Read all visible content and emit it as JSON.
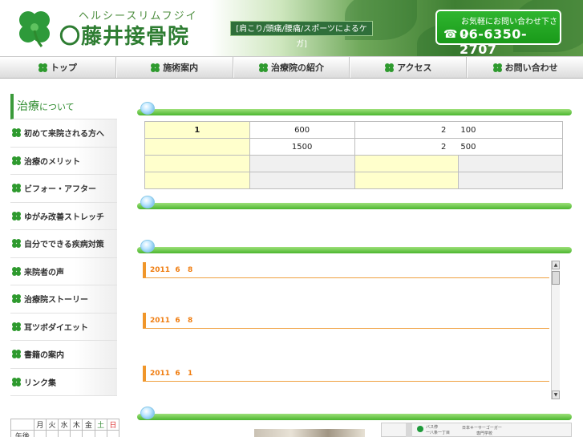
{
  "header": {
    "logo_kana": "ヘルシースリムフジイ",
    "logo_name": "〇藤井接骨院",
    "tagline": "[肩こり/頭痛/腰痛/スポーツによるケガ]",
    "contact_label": "お気軽にお問い合わせ下さい",
    "phone": "06-6350-2707",
    "phone_icon": "☎"
  },
  "nav": {
    "items": [
      "トップ",
      "施術案内",
      "治療院の紹介",
      "アクセス",
      "お問い合わせ"
    ]
  },
  "sidebar": {
    "title_main": "治療",
    "title_sub": "について",
    "items": [
      "初めて来院される方へ",
      "治療のメリット",
      "ビフォー・アフター",
      "ゆがみ改善ストレッチ",
      "自分でできる疾病対策",
      "来院者の声",
      "治療院ストーリー",
      "耳ツボダイエット",
      "書籍の案内",
      "リンク集"
    ]
  },
  "calendar": {
    "weekdays": [
      "月",
      "火",
      "水",
      "木",
      "金",
      "土",
      "日"
    ],
    "row2_first": "午後"
  },
  "price_table": {
    "rows": [
      [
        "1",
        "600",
        "2",
        "100"
      ],
      [
        "",
        "1500",
        "2",
        "500"
      ]
    ]
  },
  "news": {
    "items": [
      {
        "year": "2011",
        "month": "6",
        "day": "8"
      },
      {
        "year": "2011",
        "month": "6",
        "day": "8"
      },
      {
        "year": "2011",
        "month": "6",
        "day": "1"
      }
    ],
    "scroll_up": "▲",
    "scroll_down": "▼"
  },
  "map": {
    "label_1": "日本キーサーゴーガー",
    "label_2": "専門学校",
    "label_3": "バス停",
    "label_4": "一八条一丁目"
  },
  "colors": {
    "brand_green": "#2e7d32",
    "accent_orange": "#f07d10",
    "table_highlight": "#ffffcc"
  }
}
